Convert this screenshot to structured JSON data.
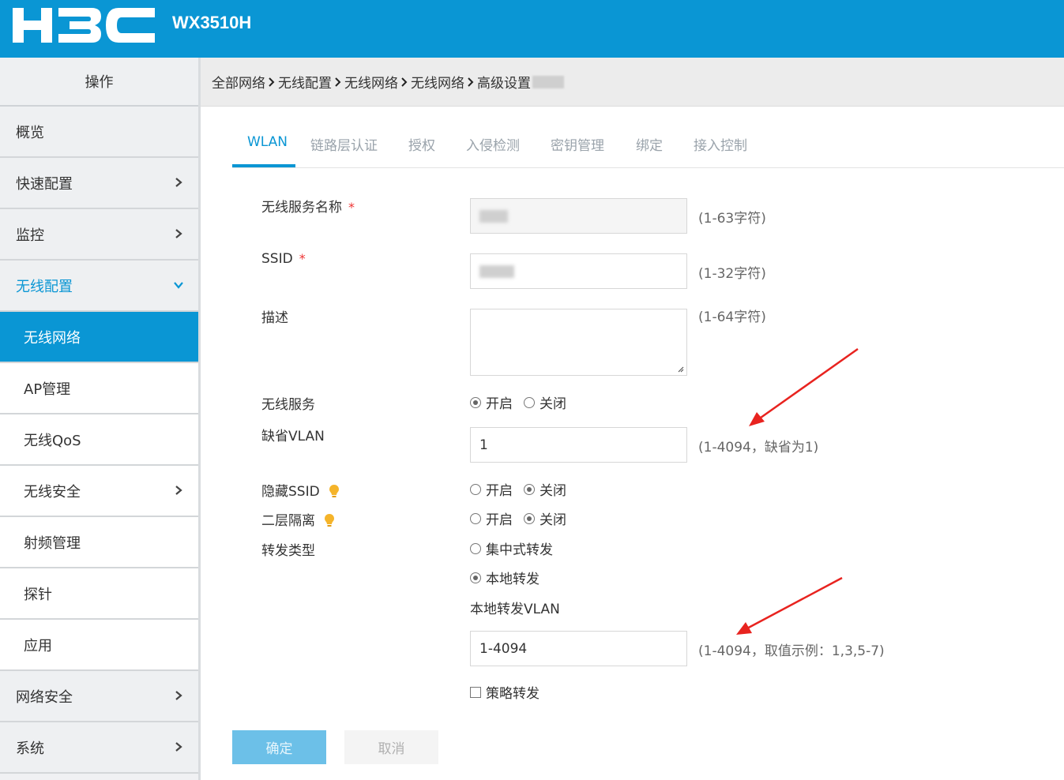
{
  "header": {
    "logo": "H3C",
    "model": "WX3510H"
  },
  "sidebar": {
    "title": "操作",
    "items": [
      {
        "label": "概览"
      },
      {
        "label": "快速配置"
      },
      {
        "label": "监控"
      },
      {
        "label": "无线配置"
      },
      {
        "label": "无线网络"
      },
      {
        "label": "AP管理"
      },
      {
        "label": "无线QoS"
      },
      {
        "label": "无线安全"
      },
      {
        "label": "射频管理"
      },
      {
        "label": "探针"
      },
      {
        "label": "应用"
      },
      {
        "label": "网络安全"
      },
      {
        "label": "系统"
      }
    ]
  },
  "breadcrumb": [
    "全部网络",
    "无线配置",
    "无线网络",
    "无线网络",
    "高级设置"
  ],
  "tabs": [
    "WLAN",
    "链路层认证",
    "授权",
    "入侵检测",
    "密钥管理",
    "绑定",
    "接入控制"
  ],
  "form": {
    "service_name": {
      "label": "无线服务名称",
      "required": "*",
      "hint": "(1-63字符)"
    },
    "ssid": {
      "label": "SSID",
      "required": "*",
      "hint": "(1-32字符)"
    },
    "description": {
      "label": "描述",
      "hint": "(1-64字符)"
    },
    "wireless_service": {
      "label": "无线服务",
      "on": "开启",
      "off": "关闭",
      "selected": "on"
    },
    "default_vlan": {
      "label": "缺省VLAN",
      "value": "1",
      "hint": "(1-4094，缺省为1)"
    },
    "hide_ssid": {
      "label": "隐藏SSID",
      "on": "开启",
      "off": "关闭",
      "selected": "off"
    },
    "l2_isolation": {
      "label": "二层隔离",
      "on": "开启",
      "off": "关闭",
      "selected": "off"
    },
    "forward_type": {
      "label": "转发类型",
      "central": "集中式转发",
      "local": "本地转发",
      "selected": "local"
    },
    "local_forward_vlan": {
      "label": "本地转发VLAN",
      "value": "1-4094",
      "hint": "(1-4094，取值示例：1,3,5-7)"
    },
    "policy_forward": {
      "label": "策略转发"
    }
  },
  "buttons": {
    "ok": "确定",
    "cancel": "取消"
  },
  "colors": {
    "brand": "#0a96d4",
    "arrow": "#e8231f",
    "required": "#e33333"
  }
}
